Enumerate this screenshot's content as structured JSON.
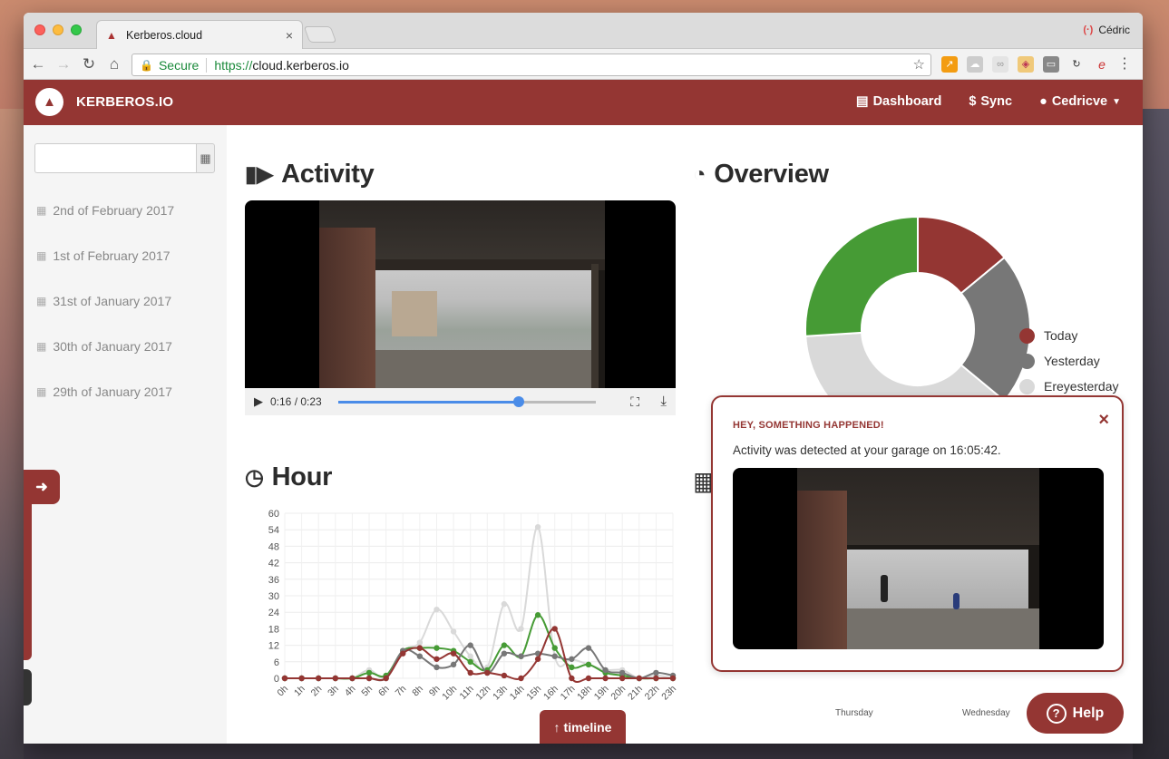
{
  "browser": {
    "tab_title": "Kerberos.cloud",
    "tab_close": "×",
    "profile_name": "Cédric",
    "secure_label": "Secure",
    "url_protocol": "https://",
    "url_host": "cloud.kerberos.io"
  },
  "navbar": {
    "brand": "KERBEROS.IO",
    "links": [
      {
        "label": "Dashboard",
        "icon": "area-chart-icon"
      },
      {
        "label": "Sync",
        "icon": "dollar-icon"
      },
      {
        "label": "Cedricve",
        "icon": "user-icon"
      }
    ]
  },
  "sidebar": {
    "date_input_placeholder": "",
    "days": [
      "2nd of February 2017",
      "1st of February 2017",
      "31st of January 2017",
      "30th of January 2017",
      "29th of January 2017"
    ]
  },
  "activity": {
    "title": "Activity",
    "time_display": "0:16 / 0:23",
    "progress": 0.7
  },
  "overview": {
    "title": "Overview"
  },
  "hour": {
    "title": "Hour"
  },
  "radar": {
    "labels": [
      "Thursday",
      "Wednesday"
    ]
  },
  "notification": {
    "heading": "HEY, SOMETHING HAPPENED!",
    "close": "×",
    "message": "Activity was detected at your garage on 16:05:42."
  },
  "help_label": "Help",
  "timeline_label": "timeline",
  "colors": {
    "brand": "#943633",
    "today": "#943633",
    "yesterday": "#777777",
    "ereyesterday": "#d9d9d9",
    "green": "#469b35"
  },
  "chart_data": [
    {
      "type": "pie",
      "title": "",
      "labels": [
        "Today",
        "Yesterday",
        "Ereyesterday",
        ""
      ],
      "values": [
        14,
        22,
        38,
        26
      ],
      "colors": [
        "#943633",
        "#777777",
        "#d9d9d9",
        "#469b35"
      ],
      "legend": "right"
    },
    {
      "type": "line",
      "title": "",
      "categories": [
        "0h",
        "1h",
        "2h",
        "3h",
        "4h",
        "5h",
        "6h",
        "7h",
        "8h",
        "9h",
        "10h",
        "11h",
        "12h",
        "13h",
        "14h",
        "15h",
        "16h",
        "17h",
        "18h",
        "19h",
        "20h",
        "21h",
        "22h",
        "23h"
      ],
      "ylim": [
        0,
        60
      ],
      "yticks": [
        0,
        6,
        12,
        18,
        24,
        30,
        36,
        42,
        48,
        54,
        60
      ],
      "grid": true,
      "series": [
        {
          "color": "#943633",
          "values": [
            0,
            0,
            0,
            0,
            0,
            0,
            0,
            9,
            11,
            7,
            9,
            2,
            2,
            1,
            0,
            7,
            18,
            0,
            0,
            0,
            0,
            0,
            0,
            0
          ]
        },
        {
          "color": "#777777",
          "values": [
            0,
            0,
            0,
            0,
            0,
            0,
            0,
            10,
            8,
            4,
            5,
            12,
            2,
            9,
            8,
            9,
            8,
            7,
            11,
            3,
            2,
            0,
            2,
            1
          ]
        },
        {
          "color": "#469b35",
          "values": [
            0,
            0,
            0,
            0,
            0,
            2,
            1,
            10,
            11,
            11,
            10,
            6,
            3,
            12,
            8,
            23,
            11,
            4,
            5,
            2,
            1,
            0,
            0,
            0
          ]
        },
        {
          "color": "#d9d9d9",
          "values": [
            0,
            0,
            0,
            0,
            0,
            3,
            0,
            10,
            13,
            25,
            17,
            8,
            4,
            27,
            18,
            55,
            8,
            7,
            5,
            3,
            3,
            0,
            1,
            0
          ]
        }
      ]
    }
  ]
}
